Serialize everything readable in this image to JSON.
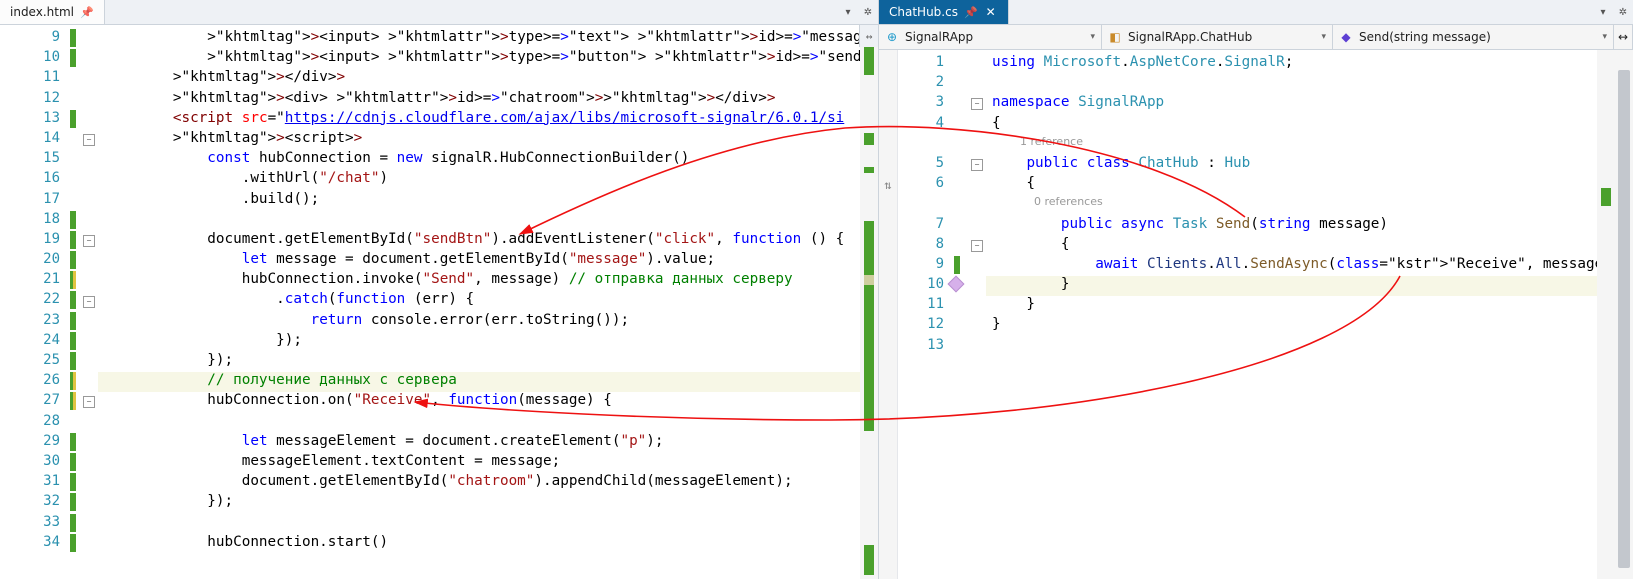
{
  "tabs": {
    "left": "index.html",
    "right": "ChatHub.cs"
  },
  "navbar": {
    "ns": "SignalRApp",
    "cls": "SignalRApp.ChatHub",
    "member": "Send(string message)"
  },
  "left": {
    "startLine": 9,
    "lines": [
      {
        "t": "            <input type=\"text\" id=\"message\" />",
        "mark": "g"
      },
      {
        "t": "            <input type=\"button\" id=\"sendBtn\" value=\"Отправить\" />",
        "mark": "g"
      },
      {
        "t": "        </div>",
        "mark": ""
      },
      {
        "t": "        <div id=\"chatroom\"></div>",
        "mark": ""
      },
      {
        "t": "        <script src=\"https://cdnjs.cloudflare.com/ajax/libs/microsoft-signalr/6.0.1/si",
        "mark": "g"
      },
      {
        "t": "        <script>",
        "mark": "",
        "fold": "box"
      },
      {
        "t": "            const hubConnection = new signalR.HubConnectionBuilder()",
        "mark": ""
      },
      {
        "t": "                .withUrl(\"/chat\")",
        "mark": ""
      },
      {
        "t": "                .build();",
        "mark": ""
      },
      {
        "t": "",
        "mark": "g"
      },
      {
        "t": "            document.getElementById(\"sendBtn\").addEventListener(\"click\", function () {",
        "mark": "g",
        "fold": "box"
      },
      {
        "t": "                let message = document.getElementById(\"message\").value;",
        "mark": "g"
      },
      {
        "t": "                hubConnection.invoke(\"Send\", message) // отправка данных серверу",
        "mark": "y"
      },
      {
        "t": "                    .catch(function (err) {",
        "mark": "g",
        "fold": "box"
      },
      {
        "t": "                        return console.error(err.toString());",
        "mark": "g"
      },
      {
        "t": "                    });",
        "mark": "g"
      },
      {
        "t": "            });",
        "mark": "g"
      },
      {
        "t": "            // получение данных с сервера",
        "mark": "y",
        "hl": true
      },
      {
        "t": "            hubConnection.on(\"Receive\", function(message) {",
        "mark": "y",
        "fold": "box"
      },
      {
        "t": "",
        "mark": ""
      },
      {
        "t": "                let messageElement = document.createElement(\"p\");",
        "mark": "g"
      },
      {
        "t": "                messageElement.textContent = message;",
        "mark": "g"
      },
      {
        "t": "                document.getElementById(\"chatroom\").appendChild(messageElement);",
        "mark": "g"
      },
      {
        "t": "            });",
        "mark": "g"
      },
      {
        "t": "",
        "mark": "g"
      },
      {
        "t": "            hubConnection.start()",
        "mark": "g"
      }
    ]
  },
  "right": {
    "lines": [
      {
        "n": 1,
        "t": "using Microsoft.AspNetCore.SignalR;"
      },
      {
        "n": 2,
        "t": ""
      },
      {
        "n": 3,
        "t": "namespace SignalRApp",
        "fold": "box"
      },
      {
        "n": 4,
        "t": "{"
      },
      {
        "n": "",
        "t": "        1 reference",
        "lens": true
      },
      {
        "n": 5,
        "t": "    public class ChatHub : Hub",
        "fold": "box"
      },
      {
        "n": 6,
        "t": "    {"
      },
      {
        "n": "",
        "t": "            0 references",
        "lens": true
      },
      {
        "n": 7,
        "t": "        public async Task Send(string message)"
      },
      {
        "n": 8,
        "t": "        {",
        "fold": "box"
      },
      {
        "n": 9,
        "t": "            await Clients.All.SendAsync(\"Receive\", message",
        "mark": "g"
      },
      {
        "n": 10,
        "t": "        }",
        "cur": true,
        "methodIcon": true
      },
      {
        "n": 11,
        "t": "    }"
      },
      {
        "n": 12,
        "t": "}"
      },
      {
        "n": 13,
        "t": ""
      }
    ]
  }
}
